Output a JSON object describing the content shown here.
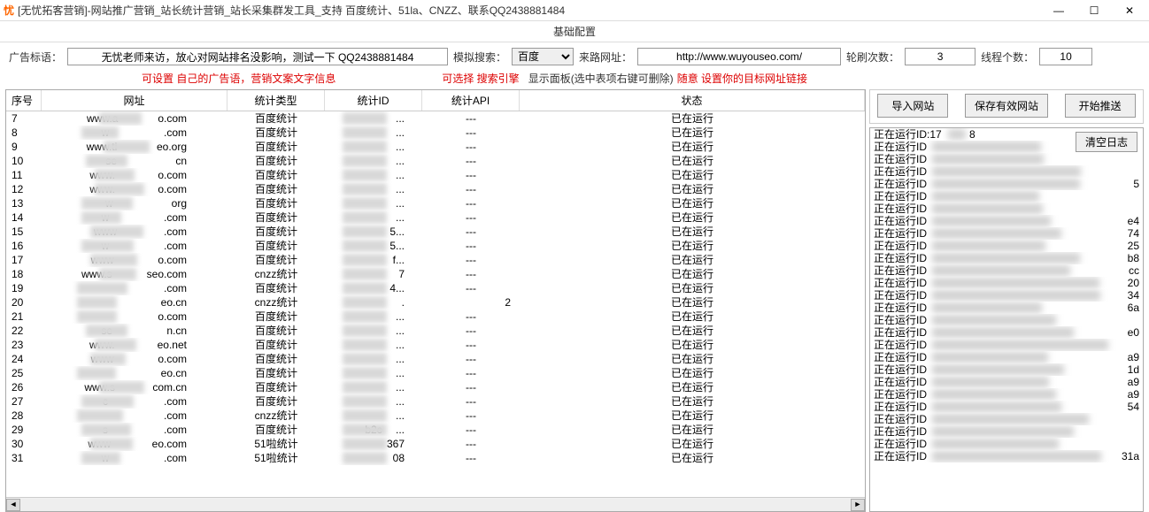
{
  "titlebar": {
    "icon_text": "忧",
    "title": "[无忧拓客营销]-网站推广营销_站长统计营销_站长采集群发工具_支持 百度统计、51la、CNZZ、联系QQ2438881484",
    "min": "—",
    "max": "☐",
    "close": "✕"
  },
  "section_header": "基础配置",
  "config": {
    "ad_label": "广告标语：",
    "ad_value": "无忧老师来访，放心对网站排名没影响，测试一下 QQ2438881484",
    "search_label": "模拟搜索：",
    "search_value": "百度",
    "url_label": "来路网址：",
    "url_value": "http://www.wuyouseo.com/",
    "rounds_label": "轮刷次数：",
    "rounds_value": "3",
    "threads_label": "线程个数：",
    "threads_value": "10"
  },
  "hints": {
    "h1": "可设置 自己的广告语，营销文案文字信息",
    "h2": "可选择 搜索引擎",
    "h3_black": "显示面板(选中表项右键可删除)",
    "h3_red": "随意 设置你的目标网址链接"
  },
  "table": {
    "headers": [
      "序号",
      "网址",
      "统计类型",
      "统计ID",
      "统计API",
      "状态"
    ],
    "rows": [
      {
        "n": "7",
        "url_pre": "www.a",
        "url_suf": "o.com",
        "type": "百度统计",
        "id_suf": "...",
        "api": "---",
        "status": "已在运行"
      },
      {
        "n": "8",
        "url_pre": "w",
        "url_suf": ".com",
        "type": "百度统计",
        "id_suf": "...",
        "api": "---",
        "status": "已在运行"
      },
      {
        "n": "9",
        "url_pre": "www.ti",
        "url_suf": "eo.org",
        "type": "百度统计",
        "id_suf": "...",
        "api": "---",
        "status": "已在运行"
      },
      {
        "n": "10",
        "url_pre": "se",
        "url_suf": "cn",
        "type": "百度统计",
        "id_suf": "...",
        "api": "---",
        "status": "已在运行"
      },
      {
        "n": "11",
        "url_pre": "www.",
        "url_suf": "o.com",
        "type": "百度统计",
        "id_suf": "...",
        "api": "---",
        "status": "已在运行"
      },
      {
        "n": "12",
        "url_pre": "www.",
        "url_suf": "o.com",
        "type": "百度统计",
        "id_suf": "...",
        "api": "---",
        "status": "已在运行"
      },
      {
        "n": "13",
        "url_pre": "w",
        "url_suf": "org",
        "type": "百度统计",
        "id_suf": "...",
        "api": "---",
        "status": "已在运行"
      },
      {
        "n": "14",
        "url_pre": "w",
        "url_suf": ".com",
        "type": "百度统计",
        "id_suf": "...",
        "api": "---",
        "status": "已在运行"
      },
      {
        "n": "15",
        "url_pre": "www",
        "url_suf": ".com",
        "type": "百度统计",
        "id_suf": "5...",
        "api": "---",
        "status": "已在运行"
      },
      {
        "n": "16",
        "url_pre": "w",
        "url_suf": ".com",
        "type": "百度统计",
        "id_suf": "5...",
        "api": "---",
        "status": "已在运行"
      },
      {
        "n": "17",
        "url_pre": "www",
        "url_suf": "o.com",
        "type": "百度统计",
        "id_suf": "f...",
        "api": "---",
        "status": "已在运行"
      },
      {
        "n": "18",
        "url_pre": "www.s",
        "url_suf": "seo.com",
        "type": "cnzz统计",
        "id_suf": "7",
        "api": "---",
        "status": "已在运行"
      },
      {
        "n": "19",
        "url_pre": "",
        "url_suf": ".com",
        "type": "百度统计",
        "id_suf": "4...",
        "api": "---",
        "status": "已在运行"
      },
      {
        "n": "20",
        "url_pre": "",
        "url_suf": "eo.cn",
        "type": "cnzz统计",
        "id_suf": ".",
        "api2": "2",
        "api": "",
        "status": "已在运行"
      },
      {
        "n": "21",
        "url_pre": "",
        "url_suf": "o.com",
        "type": "百度统计",
        "id_suf": "...",
        "api": "---",
        "status": "已在运行"
      },
      {
        "n": "22",
        "url_pre": "se",
        "url_suf": "n.cn",
        "type": "百度统计",
        "id_suf": "...",
        "api": "---",
        "status": "已在运行"
      },
      {
        "n": "23",
        "url_pre": "www.",
        "url_suf": "eo.net",
        "type": "百度统计",
        "id_suf": "...",
        "api": "---",
        "status": "已在运行"
      },
      {
        "n": "24",
        "url_pre": "www",
        "url_suf": "o.com",
        "type": "百度统计",
        "id_suf": "...",
        "api": "---",
        "status": "已在运行"
      },
      {
        "n": "25",
        "url_pre": "",
        "url_suf": "eo.cn",
        "type": "百度统计",
        "id_suf": "...",
        "api": "---",
        "status": "已在运行"
      },
      {
        "n": "26",
        "url_pre": "www.s",
        "url_suf": "com.cn",
        "type": "百度统计",
        "id_suf": "...",
        "api": "---",
        "status": "已在运行"
      },
      {
        "n": "27",
        "url_pre": "c",
        "url_suf": ".com",
        "type": "百度统计",
        "id_suf": "...",
        "api": "---",
        "status": "已在运行"
      },
      {
        "n": "28",
        "url_pre": "",
        "url_suf": ".com",
        "type": "cnzz统计",
        "id_suf": "...",
        "api": "---",
        "status": "已在运行"
      },
      {
        "n": "29",
        "url_pre": "s",
        "url_suf": ".com",
        "type": "百度统计",
        "id_pre": "b2c",
        "id_suf": "...",
        "api": "---",
        "status": "已在运行"
      },
      {
        "n": "30",
        "url_pre": "www",
        "url_suf": "eo.com",
        "type": "51啦统计",
        "id_suf": "367",
        "api": "---",
        "status": "已在运行"
      },
      {
        "n": "31",
        "url_pre": "w",
        "url_suf": ".com",
        "type": "51啦统计",
        "id_suf": "08",
        "api": "---",
        "status": "已在运行"
      }
    ]
  },
  "side": {
    "import_btn": "导入网站",
    "save_btn": "保存有效网站",
    "start_btn": "开始推送",
    "clear_log": "清空日志"
  },
  "log_prefix": "正在运行ID",
  "log_first": "正在运行ID:17",
  "log_suffixes": [
    "8",
    "",
    "",
    "",
    "5",
    "",
    "",
    "e4",
    "74",
    "25",
    "b8",
    "cc",
    "20",
    "34",
    "6a",
    "",
    "e0",
    "",
    "a9",
    "1d",
    "a9",
    "a9",
    "54",
    "",
    "",
    "",
    "31a"
  ]
}
